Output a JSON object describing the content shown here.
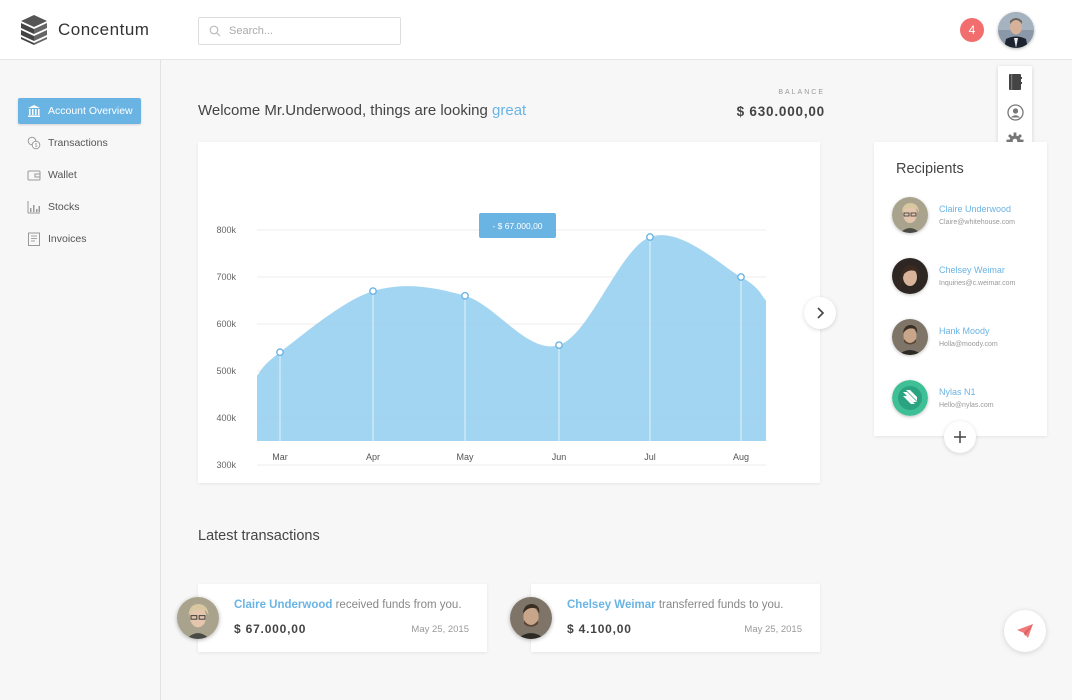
{
  "app": {
    "name": "Concentum"
  },
  "search": {
    "placeholder": "Search..."
  },
  "header": {
    "notification_count": "4"
  },
  "user_menu": {
    "items": [
      "notebook-icon",
      "profile-icon",
      "settings-icon",
      "power-icon"
    ]
  },
  "sidebar": {
    "items": [
      {
        "label": "Account Overview",
        "icon": "bank-icon",
        "active": true
      },
      {
        "label": "Transactions",
        "icon": "coins-icon",
        "active": false
      },
      {
        "label": "Wallet",
        "icon": "wallet-icon",
        "active": false
      },
      {
        "label": "Stocks",
        "icon": "bar-chart-icon",
        "active": false
      },
      {
        "label": "Invoices",
        "icon": "invoice-icon",
        "active": false
      }
    ]
  },
  "welcome": {
    "prefix": "Welcome Mr.Underwood, things are looking ",
    "accent": "great"
  },
  "balance": {
    "label": "BALANCE",
    "value": "$ 630.000,00"
  },
  "chart_data": {
    "type": "area",
    "categories": [
      "Mar",
      "Apr",
      "May",
      "Jun",
      "Jul",
      "Aug"
    ],
    "values": [
      540000,
      670000,
      660000,
      555000,
      785000,
      700000
    ],
    "start_value": 490000,
    "end_value": 650000,
    "y_ticks": [
      "300k",
      "400k",
      "500k",
      "600k",
      "700k",
      "800k"
    ],
    "ylim": [
      250000,
      850000
    ],
    "tooltip": {
      "label": "- $ 67.000,00"
    },
    "color": "#9dd3f0",
    "grid": true
  },
  "recipients": {
    "title": "Recipients",
    "items": [
      {
        "name": "Claire Underwood",
        "email": "Claire@whitehouse.com"
      },
      {
        "name": "Chelsey Weimar",
        "email": "Inquiries@c.weimar.com"
      },
      {
        "name": "Hank Moody",
        "email": "Holla@moody.com"
      },
      {
        "name": "Nylas N1",
        "email": "Hello@nylas.com"
      }
    ]
  },
  "transactions": {
    "title": "Latest transactions",
    "items": [
      {
        "name": "Claire Underwood",
        "action": " received funds from you.",
        "amount": "$ 67.000,00",
        "date": "May 25, 2015"
      },
      {
        "name": "Chelsey Weimar",
        "action": " transferred funds to you.",
        "amount": "$ 4.100,00",
        "date": "May 25, 2015"
      }
    ]
  },
  "colors": {
    "accent": "#6ab4e4",
    "badge": "#f26d6d",
    "send": "#f07a7a"
  }
}
